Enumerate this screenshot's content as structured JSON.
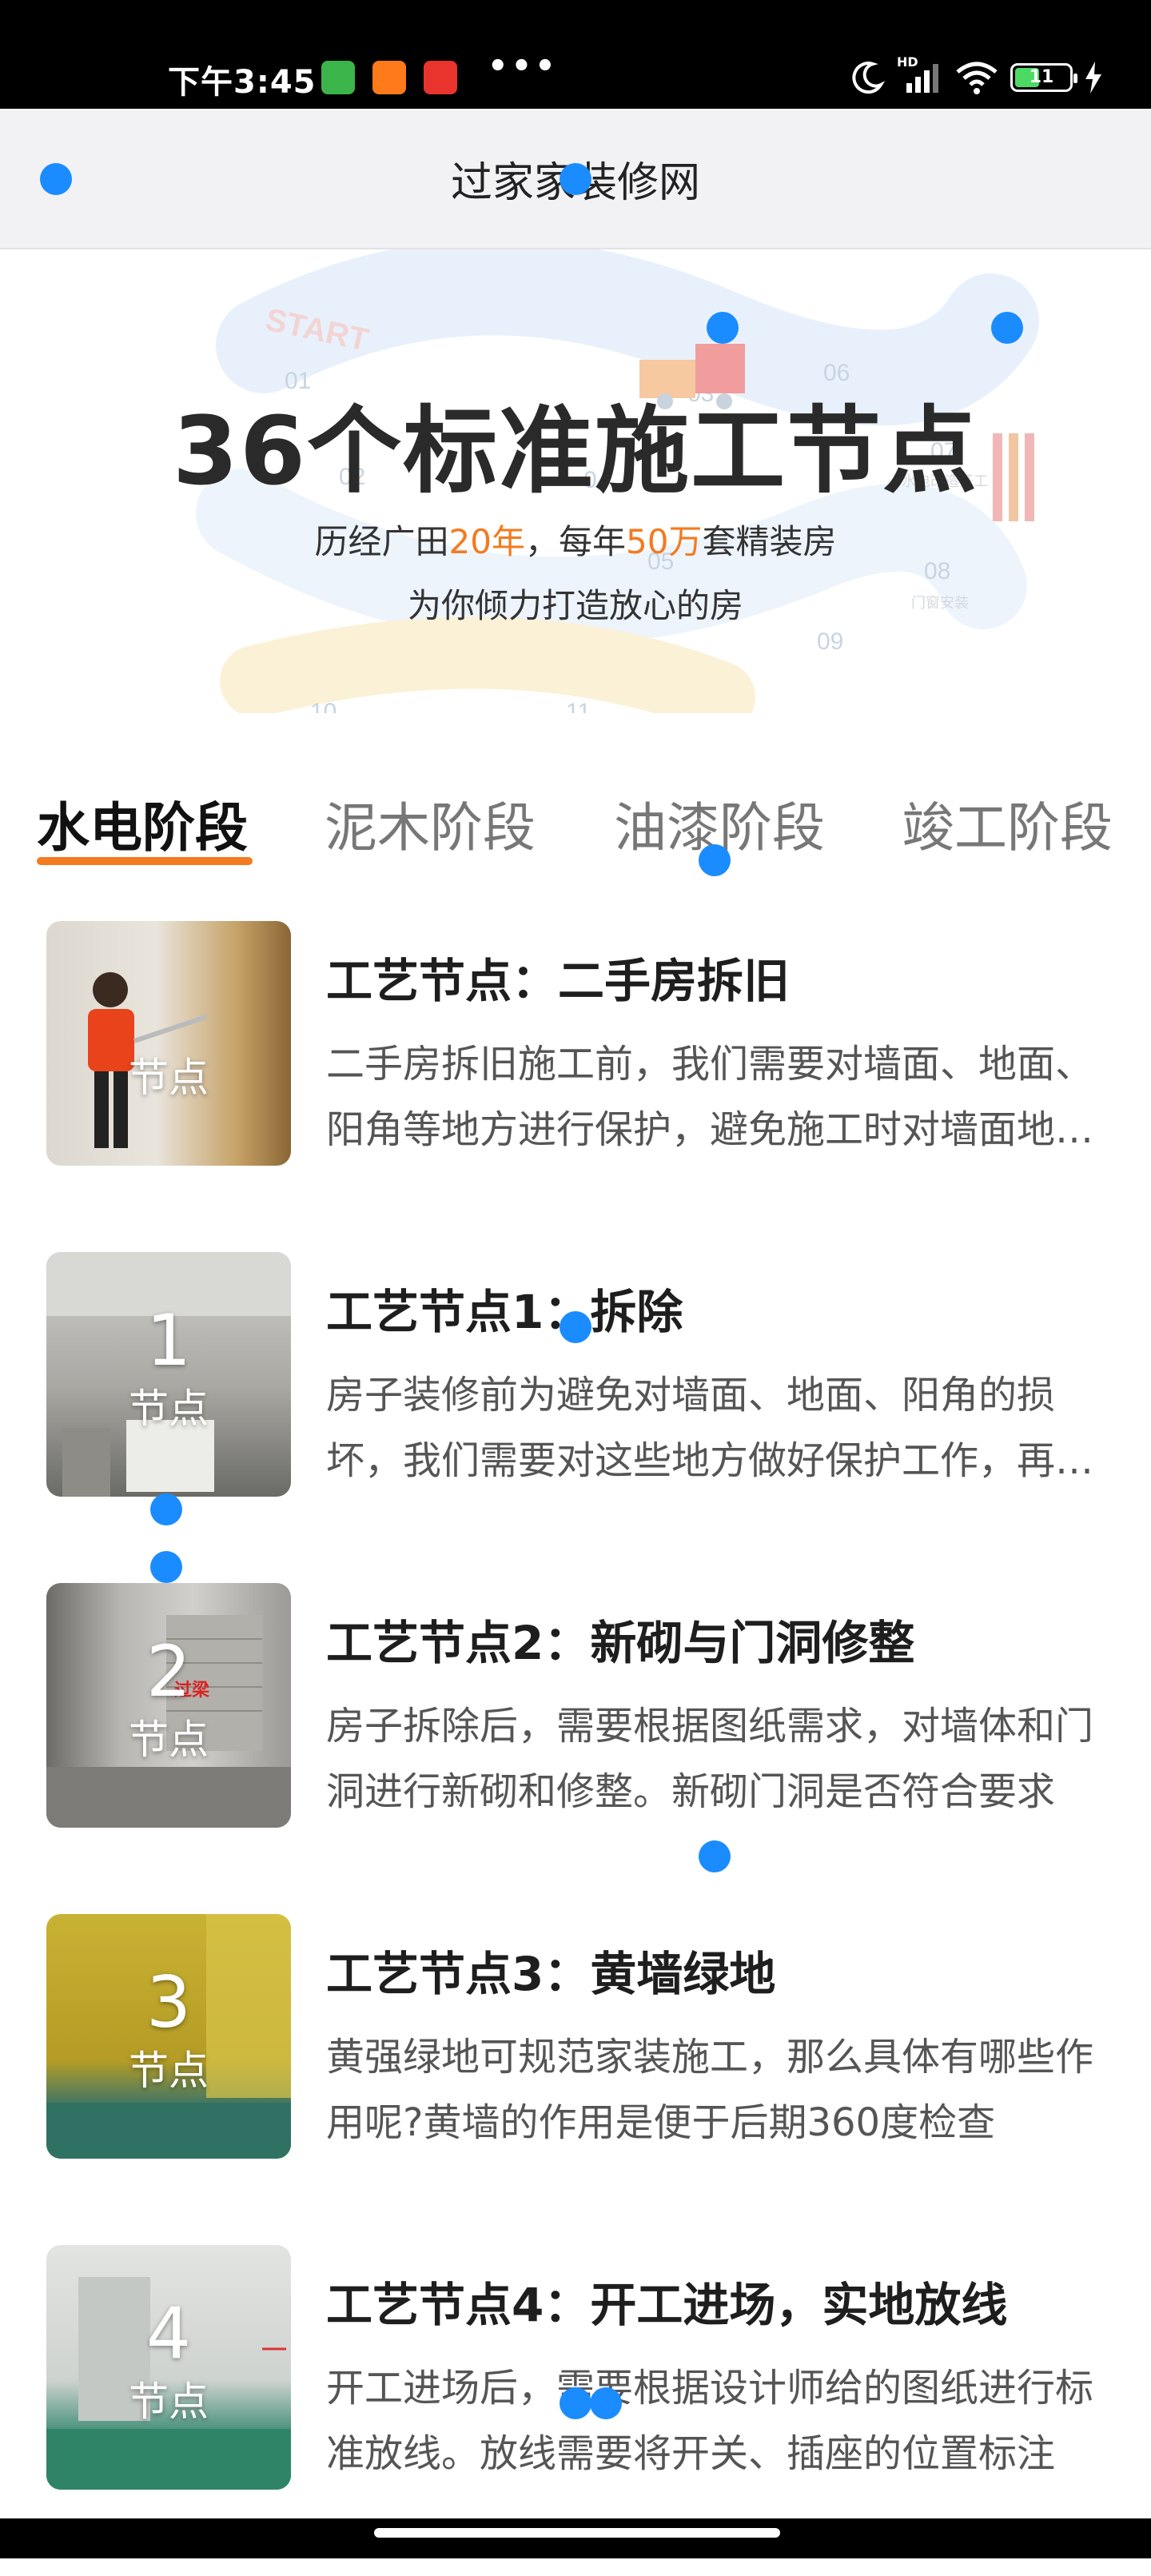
{
  "status_bar": {
    "time": "下午3:45",
    "dots": "•••",
    "network": "HD",
    "battery": "11"
  },
  "nav": {
    "title": "过家家装修网"
  },
  "banner": {
    "title": "36个标准施工节点",
    "sub1_prefix": "历经广田",
    "sub1_hl1": "20年",
    "sub1_mid": "，每年",
    "sub1_hl2": "50万",
    "sub1_suffix": "套精装房",
    "sub2": "为你倾力打造放心的房",
    "bg_texts": [
      "START",
      "01",
      "02",
      "03",
      "04",
      "05",
      "06",
      "07",
      "08",
      "09",
      "10",
      "11",
      "水电改造开工",
      "门窗安装"
    ],
    "accent_color": "#f47a1f"
  },
  "tabs": [
    {
      "label": "水电阶段",
      "active": true
    },
    {
      "label": "泥木阶段",
      "active": false
    },
    {
      "label": "油漆阶段",
      "active": false
    },
    {
      "label": "竣工阶段",
      "active": false
    }
  ],
  "items": [
    {
      "num": "",
      "label": "节点",
      "title": "工艺节点：二手房拆旧",
      "desc": "二手房拆旧施工前，我们需要对墙面、地面、阳角等地方进行保护，避免施工时对墙面地面造成损坏"
    },
    {
      "num": "1",
      "label": "节点",
      "title": "工艺节点1：拆除",
      "desc": "房子装修前为避免对墙面、地面、阳角的损坏，我们需要对这些地方做好保护工作，再进行拆除"
    },
    {
      "num": "2",
      "label": "节点",
      "title": "工艺节点2：新砌与门洞修整",
      "desc": "房子拆除后，需要根据图纸需求，对墙体和门洞进行新砌和修整。新砌门洞是否符合要求"
    },
    {
      "num": "3",
      "label": "节点",
      "title": "工艺节点3：黄墙绿地",
      "desc": "黄强绿地可规范家装施工，那么具体有哪些作用呢?黄墙的作用是便于后期360度检查"
    },
    {
      "num": "4",
      "label": "节点",
      "title": "工艺节点4：开工进场，实地放线",
      "desc": "开工进场后，需要根据设计师给的图纸进行标准放线。放线需要将开关、插座的位置标注"
    }
  ],
  "thumb_overlay_text": "过梁"
}
